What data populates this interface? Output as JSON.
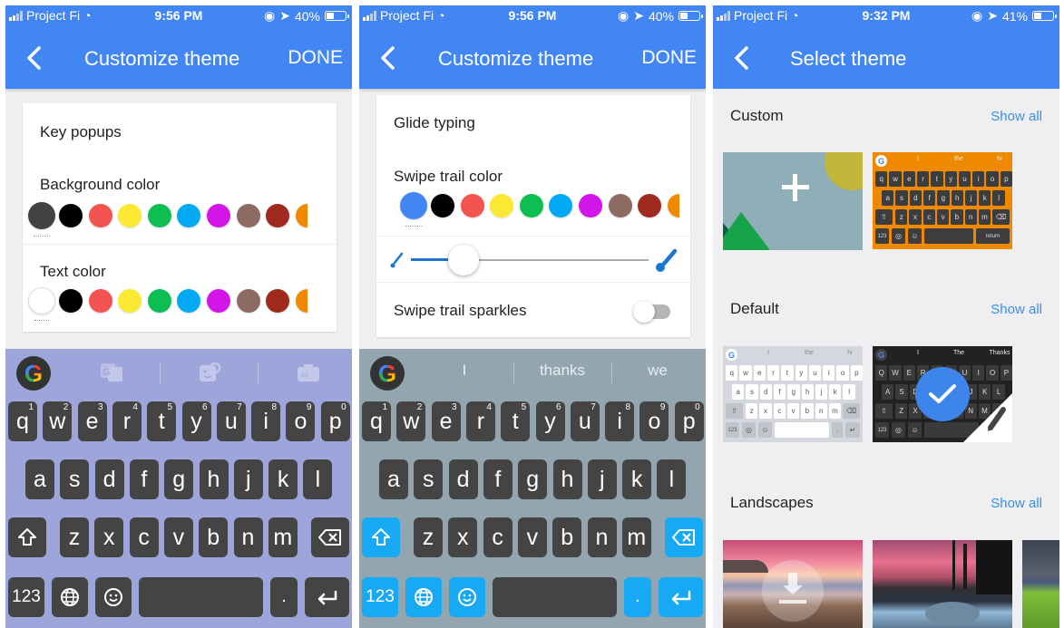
{
  "screens": [
    {
      "status": {
        "carrier": "Project Fi",
        "time": "9:56 PM",
        "battery": "40%",
        "battery_level": 0.4
      },
      "appbar": {
        "title": "Customize theme",
        "action": "DONE"
      },
      "settings": {
        "section": "Key popups",
        "background_color_label": "Background color",
        "text_color_label": "Text color",
        "background_colors": [
          "#424242",
          "#000000",
          "#f45450",
          "#fbe934",
          "#0dbe53",
          "#04a9f3",
          "#d316e8",
          "#8c6b63",
          "#a12a1e",
          "#ef8a00"
        ],
        "background_selected": 0,
        "text_colors": [
          "#ffffff",
          "#000000",
          "#f45450",
          "#fbe934",
          "#0dbe53",
          "#04a9f3",
          "#d316e8",
          "#8c6b63",
          "#a12a1e",
          "#ef8a00"
        ],
        "text_selected": 0
      },
      "keyboard": {
        "background": "#9ea5da",
        "key_color": "#444444",
        "special_key_color": "#444444",
        "toolbar_icons": [
          "translate-icon",
          "gif-sticker-search-icon",
          "camera-infinity-icon"
        ]
      }
    },
    {
      "status": {
        "carrier": "Project Fi",
        "time": "9:56 PM",
        "battery": "40%",
        "battery_level": 0.4
      },
      "appbar": {
        "title": "Customize theme",
        "action": "DONE"
      },
      "settings": {
        "section": "Glide typing",
        "swipe_trail_color_label": "Swipe trail color",
        "swipe_colors": [
          "#4286f4",
          "#000000",
          "#f45450",
          "#fbe934",
          "#0dbe53",
          "#04a9f3",
          "#d316e8",
          "#8c6b63",
          "#a12a1e",
          "#ef8a00"
        ],
        "swipe_selected": 0,
        "trail_width": 0.2,
        "sparkles_label": "Swipe trail sparkles",
        "sparkles_on": false
      },
      "keyboard": {
        "background": "#93a6b0",
        "key_color": "#444444",
        "special_key_color": "#17a9f4",
        "suggestions": [
          "I",
          "thanks",
          "we"
        ]
      }
    },
    {
      "status": {
        "carrier": "Project Fi",
        "time": "9:32 PM",
        "battery": "41%",
        "battery_level": 0.41
      },
      "appbar": {
        "title": "Select theme"
      },
      "sections": [
        {
          "title": "Custom",
          "show_all": "Show all",
          "thumbs": [
            "Add custom theme",
            "Orange theme"
          ]
        },
        {
          "title": "Default",
          "show_all": "Show all",
          "thumbs": [
            "Light theme",
            "Dark theme (selected)"
          ]
        },
        {
          "title": "Landscapes",
          "show_all": "Show all",
          "thumbs": [
            "Beach sunset",
            "Frozen waterfall",
            "Green hills"
          ]
        }
      ],
      "mini": {
        "light_suggestions": [
          "I",
          "the",
          "hi"
        ],
        "dark_suggestions": [
          "I",
          "The",
          "Thanks"
        ],
        "orange_suggestions": [
          "I",
          "the",
          "hi"
        ],
        "return_label": "return"
      }
    }
  ],
  "keys": {
    "row1": [
      "q",
      "w",
      "e",
      "r",
      "t",
      "y",
      "u",
      "i",
      "o",
      "p"
    ],
    "row1_nums": [
      "1",
      "2",
      "3",
      "4",
      "5",
      "6",
      "7",
      "8",
      "9",
      "0"
    ],
    "row2": [
      "a",
      "s",
      "d",
      "f",
      "g",
      "h",
      "j",
      "k",
      "l"
    ],
    "row3": [
      "z",
      "x",
      "c",
      "v",
      "b",
      "n",
      "m"
    ],
    "num_label": "123",
    "period": "."
  }
}
